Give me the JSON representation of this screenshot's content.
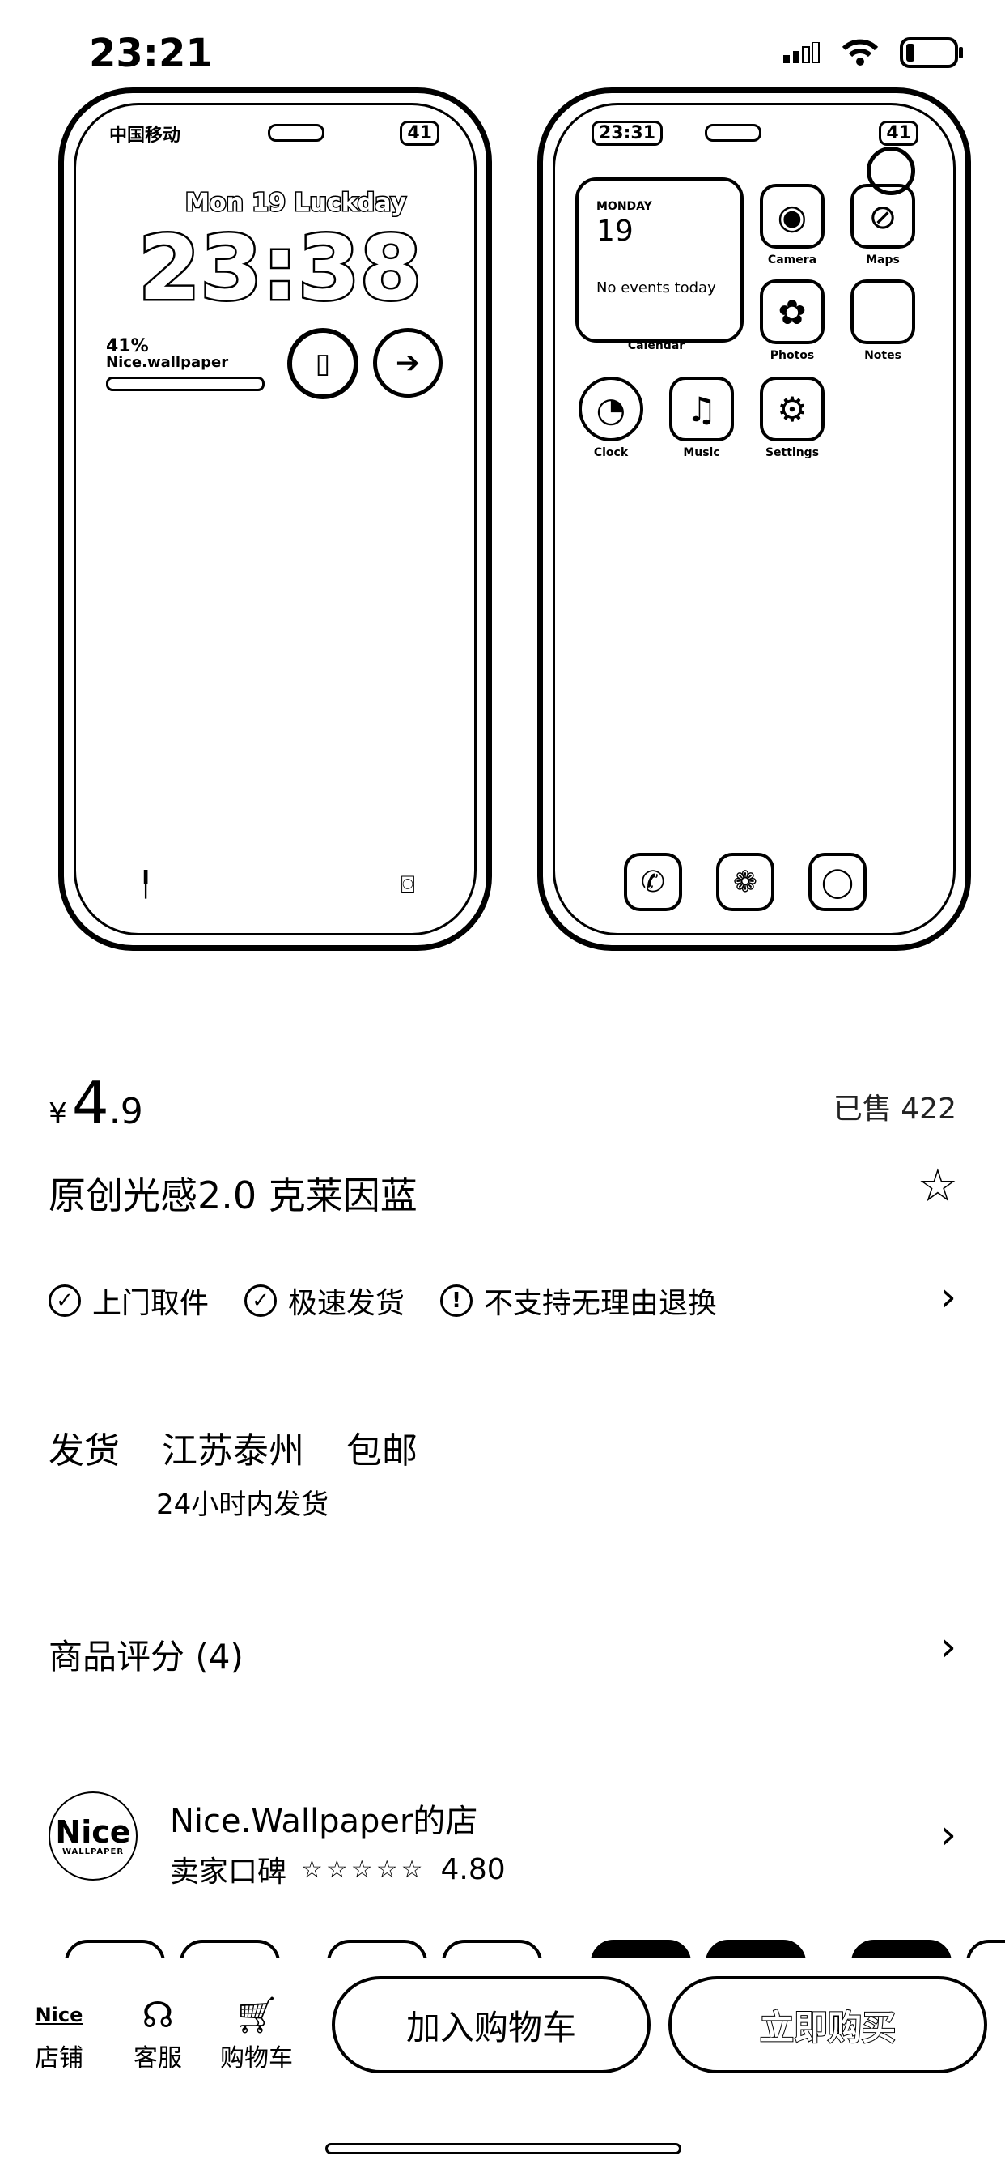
{
  "status_bar": {
    "time": "23:21"
  },
  "lock_screen": {
    "carrier": "中国移动",
    "battery": "41",
    "date_line": "Mon 19  Luckday",
    "time": "23:38",
    "widget_percent": "41%",
    "widget_label": "Nice.wallpaper"
  },
  "home_screen": {
    "time": "23:31",
    "battery": "41",
    "calendar": {
      "day": "MONDAY",
      "date": "19",
      "events": "No events today",
      "label": "Calendar"
    },
    "apps": [
      {
        "label": "Camera",
        "icon": "camera-icon"
      },
      {
        "label": "Maps",
        "icon": "maps-icon"
      },
      {
        "label": "Photos",
        "icon": "photos-icon"
      },
      {
        "label": "Notes",
        "icon": "notes-icon"
      },
      {
        "label": "Clock",
        "icon": "clock-icon"
      },
      {
        "label": "Music",
        "icon": "music-icon"
      },
      {
        "label": "Settings",
        "icon": "settings-icon"
      }
    ],
    "dock": [
      "phone-icon",
      "wechat-icon",
      "messages-icon"
    ]
  },
  "product": {
    "currency": "¥",
    "price_int": "4",
    "price_dec": ".9",
    "sold": "已售 422",
    "title": "原创光感2.0 克莱因蓝",
    "tags": [
      "上门取件",
      "极速发货",
      "不支持无理由退换"
    ]
  },
  "shipping": {
    "label": "发货",
    "origin": "江苏泰州",
    "fee": "包邮",
    "time": "24小时内发货"
  },
  "rating": {
    "label": "商品评分 (4)"
  },
  "shop": {
    "logo_main": "Nice",
    "logo_sub": "WALLPAPER",
    "name": "Nice.Wallpaper的店",
    "rep_label": "卖家口碑",
    "score": "4.80"
  },
  "bottom_bar": {
    "store_logo": "Nice",
    "store": "店铺",
    "service": "客服",
    "cart": "购物车",
    "add_to_cart": "加入购物车",
    "buy_now": "立即购买"
  }
}
